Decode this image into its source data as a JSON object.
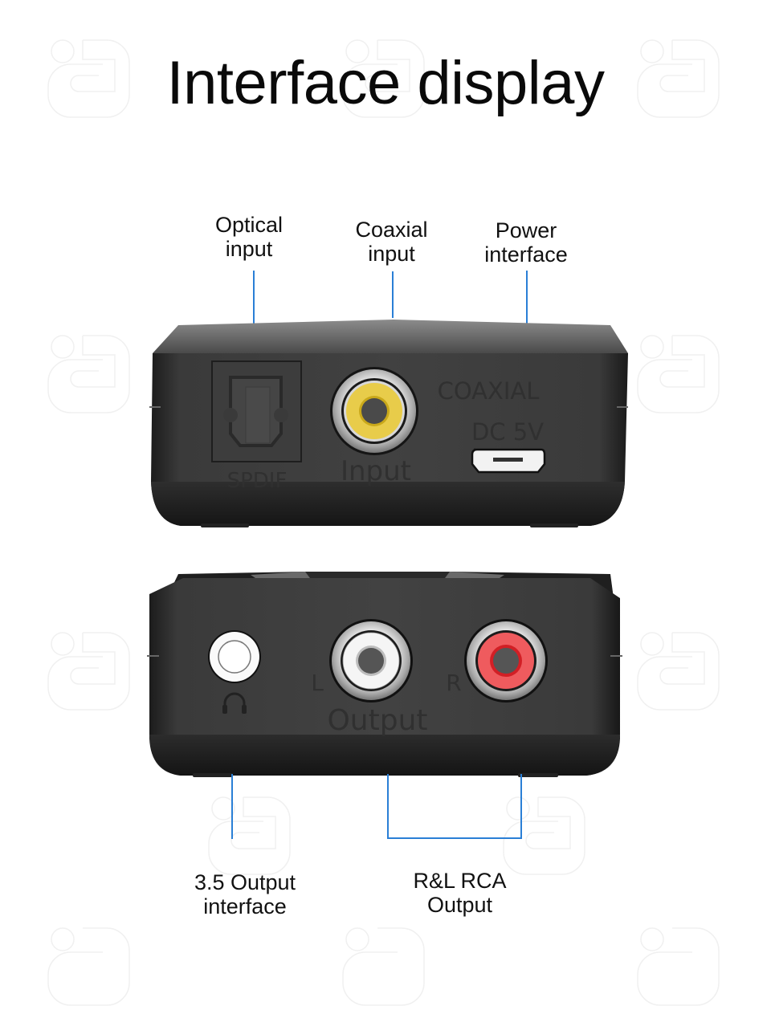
{
  "title": "Interface display",
  "top_labels": {
    "optical": "Optical\ninput",
    "coaxial": "Coaxial\ninput",
    "power": "Power\ninterface"
  },
  "bottom_labels": {
    "headphone": "3.5 Output\ninterface",
    "rca": "R&L RCA\nOutput"
  },
  "top_device": {
    "spdif_label": "SPDIF",
    "input_label": "Input",
    "coaxial_label": "COAXIAL",
    "dc_label": "DC 5V"
  },
  "bottom_device": {
    "left_label": "L",
    "right_label": "R",
    "output_label": "Output"
  },
  "colors": {
    "callout_line": "#2a7fd6",
    "coaxial_jack": "#e8cc4a",
    "rca_left": "#f4f4f4",
    "rca_right": "#ef5b5e",
    "device_body": "#3e3e3e"
  },
  "icons": {
    "headphone": "headphone-icon",
    "watermark": "brand-logo-watermark"
  }
}
